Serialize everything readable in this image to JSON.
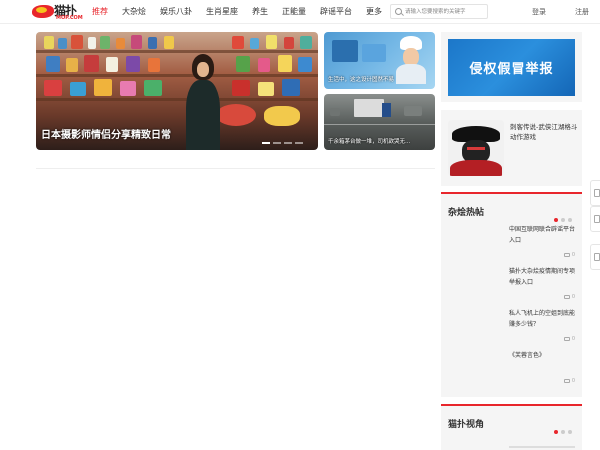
{
  "header": {
    "logo_text": "猫扑",
    "logo_sub": "MOP.COM",
    "nav": [
      {
        "label": "推荐",
        "active": true
      },
      {
        "label": "大杂烩",
        "active": false
      },
      {
        "label": "娱乐八卦",
        "active": false
      },
      {
        "label": "生肖星座",
        "active": false
      },
      {
        "label": "养生",
        "active": false
      },
      {
        "label": "正能量",
        "active": false
      },
      {
        "label": "辟谣平台",
        "active": false
      },
      {
        "label": "更多",
        "active": false
      }
    ],
    "search_placeholder": "请输入您要搜索的关键字",
    "login": "登录",
    "register": "注册"
  },
  "feature": {
    "caption": "日本摄影师情侣分享精致日常"
  },
  "side_thumbs": [
    {
      "caption": "生活中，这之设计固然不易"
    },
    {
      "caption": "千余箱茅台做一堆，司机欲哭无..."
    }
  ],
  "banner": {
    "text": "侵权假冒举报"
  },
  "game": {
    "title": "刺客传说-武侠江湖格斗动作游戏"
  },
  "hot_section": {
    "title": "杂烩热帖",
    "items": [
      {
        "text": "中国互联网联合辟谣平台入口",
        "comments": "0"
      },
      {
        "text": "猫扑大杂烩疫情期间专项举报入口",
        "comments": "0"
      },
      {
        "text": "私人飞机上的空姐到底能赚多少钱？",
        "comments": "0"
      },
      {
        "text": "《芙蓉言色》",
        "comments": "0"
      }
    ]
  },
  "cat_section": {
    "title": "猫扑视角"
  },
  "colors": {
    "accent": "#e8262c",
    "banner_blue": "#1c77c9"
  }
}
